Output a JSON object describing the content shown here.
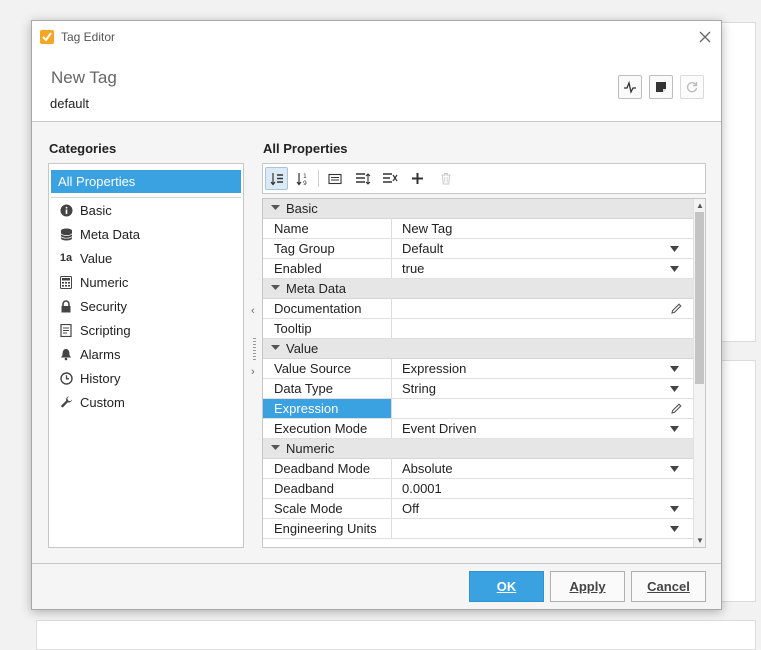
{
  "window": {
    "title": "Tag Editor",
    "icon": "app-logo-icon"
  },
  "header": {
    "tag_name": "New Tag",
    "provider": "default"
  },
  "categories": {
    "heading": "Categories",
    "selected": "All Properties",
    "items": [
      {
        "label": "Basic",
        "icon": "info-icon"
      },
      {
        "label": "Meta Data",
        "icon": "database-icon"
      },
      {
        "label": "Value",
        "icon": "value-icon"
      },
      {
        "label": "Numeric",
        "icon": "calculator-icon"
      },
      {
        "label": "Security",
        "icon": "lock-icon"
      },
      {
        "label": "Scripting",
        "icon": "script-icon"
      },
      {
        "label": "Alarms",
        "icon": "bell-icon"
      },
      {
        "label": "History",
        "icon": "clock-icon"
      },
      {
        "label": "Custom",
        "icon": "wrench-icon"
      }
    ]
  },
  "properties": {
    "heading": "All Properties",
    "value_icon_glyph": "1a",
    "groups": {
      "basic": "Basic",
      "meta": "Meta Data",
      "value": "Value",
      "numeric": "Numeric"
    },
    "rows": {
      "name": {
        "label": "Name",
        "value": "New Tag"
      },
      "tag_group": {
        "label": "Tag Group",
        "value": "Default"
      },
      "enabled": {
        "label": "Enabled",
        "value": "true"
      },
      "documentation": {
        "label": "Documentation",
        "value": ""
      },
      "tooltip": {
        "label": "Tooltip",
        "value": ""
      },
      "value_source": {
        "label": "Value Source",
        "value": "Expression"
      },
      "data_type": {
        "label": "Data Type",
        "value": "String"
      },
      "expression": {
        "label": "Expression",
        "value": ""
      },
      "execution_mode": {
        "label": "Execution Mode",
        "value": "Event Driven"
      },
      "deadband_mode": {
        "label": "Deadband Mode",
        "value": "Absolute"
      },
      "deadband": {
        "label": "Deadband",
        "value": "0.0001"
      },
      "scale_mode": {
        "label": "Scale Mode",
        "value": "Off"
      },
      "engineering_units": {
        "label": "Engineering Units",
        "value": ""
      }
    }
  },
  "buttons": {
    "ok": "OK",
    "apply": "Apply",
    "cancel": "Cancel"
  },
  "colors": {
    "accent": "#3aa2e0",
    "app_icon": "#f6a623"
  }
}
